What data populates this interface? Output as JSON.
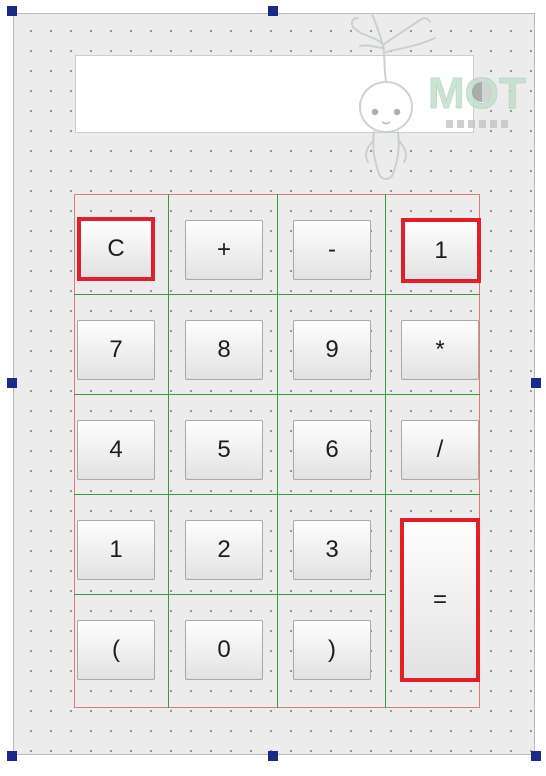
{
  "colors": {
    "form_background": "#ececec",
    "grid_dots": "#8f8f8f",
    "layout_border": "#e07a7a",
    "layout_grid_lines": "#3a9a3a",
    "selection_highlight": "#e11f2a",
    "resize_handles": "#1b2a8a"
  },
  "display": {
    "value": ""
  },
  "keypad": {
    "buttons": [
      {
        "label": "C",
        "selected": true
      },
      {
        "label": "+",
        "selected": false
      },
      {
        "label": "-",
        "selected": false
      },
      {
        "label": "1",
        "selected": true
      },
      {
        "label": "7",
        "selected": false
      },
      {
        "label": "8",
        "selected": false
      },
      {
        "label": "9",
        "selected": false
      },
      {
        "label": "*",
        "selected": false
      },
      {
        "label": "4",
        "selected": false
      },
      {
        "label": "5",
        "selected": false
      },
      {
        "label": "6",
        "selected": false
      },
      {
        "label": "/",
        "selected": false
      },
      {
        "label": "1",
        "selected": false
      },
      {
        "label": "2",
        "selected": false
      },
      {
        "label": "3",
        "selected": false
      },
      {
        "label": "=",
        "selected": true
      },
      {
        "label": "(",
        "selected": false
      },
      {
        "label": "0",
        "selected": false
      },
      {
        "label": ")",
        "selected": false
      }
    ]
  },
  "watermark": {
    "text": "MOT",
    "icon": "tree-spirit-logo-icon"
  }
}
